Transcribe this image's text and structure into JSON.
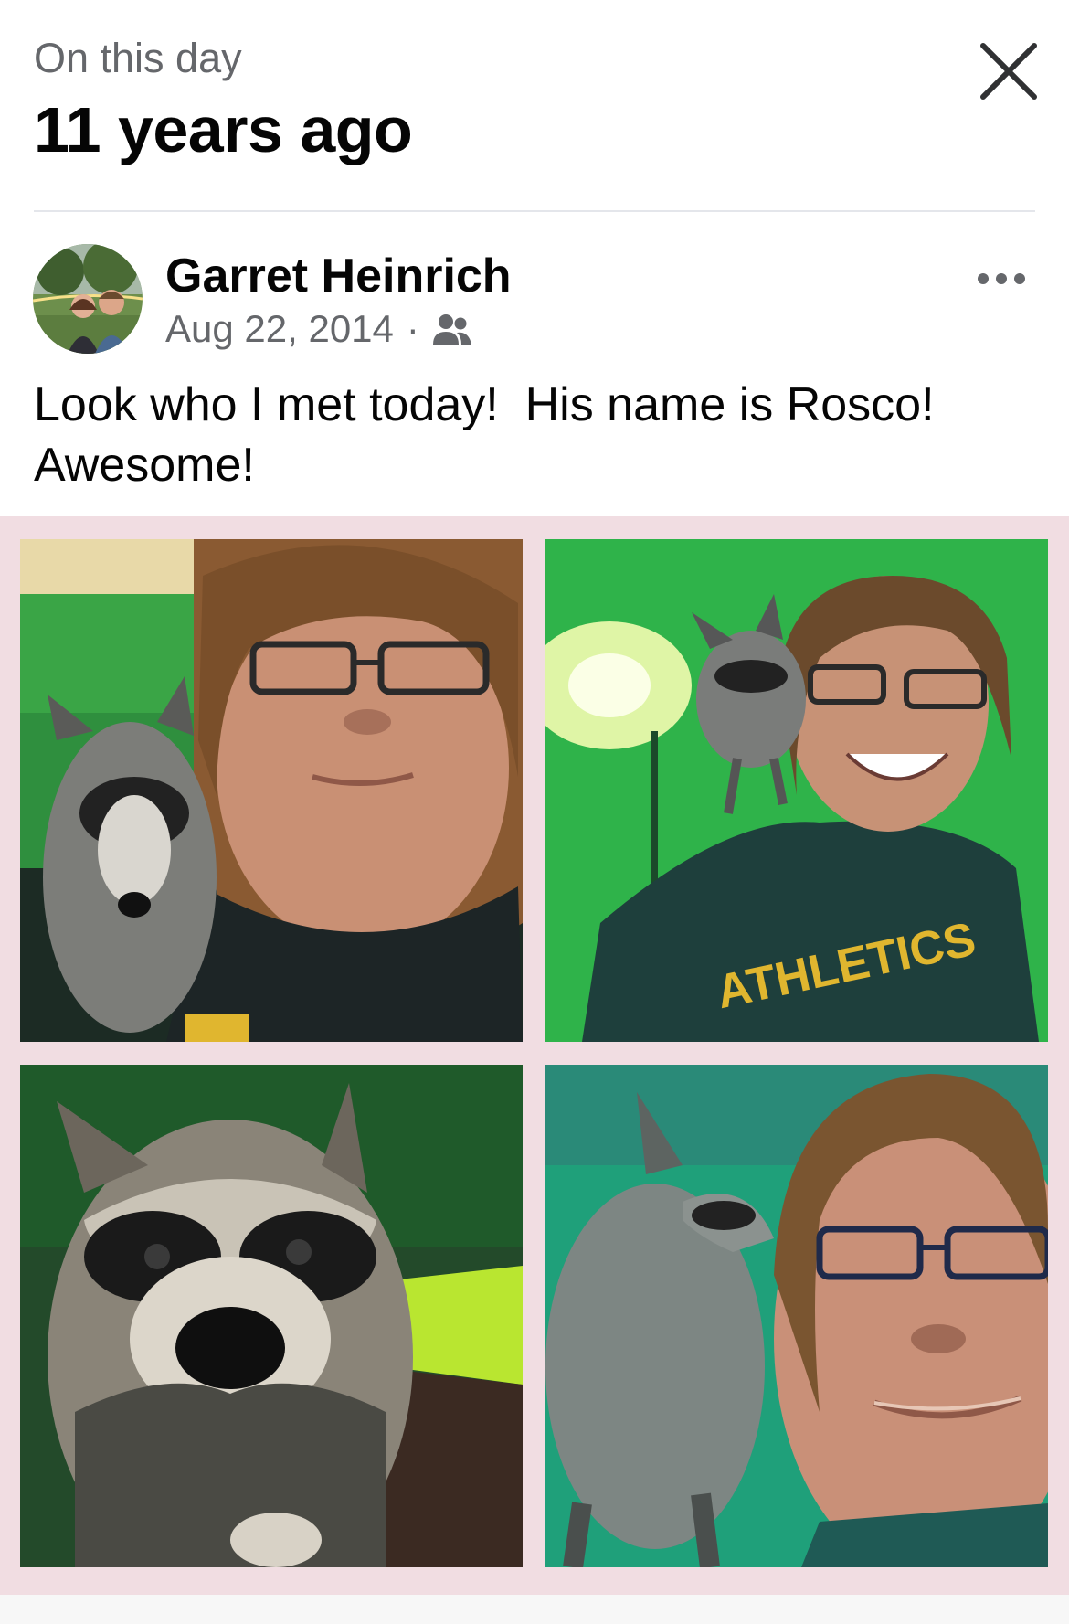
{
  "memory_header": {
    "kicker": "On this day",
    "headline": "11 years ago",
    "close_icon": "close-icon"
  },
  "post": {
    "author": "Garret Heinrich",
    "date": "Aug 22, 2014",
    "separator": "·",
    "audience_icon": "friends-icon",
    "more_icon": "more-horizontal-icon",
    "caption_line1": "Look who I met today!  His name is Rosco!",
    "caption_line2": "Awesome!",
    "tshirt_text": "ATHLETICS"
  },
  "colors": {
    "text_primary": "#050505",
    "text_secondary": "#65676b",
    "collage_border": "#f1dde2",
    "wall_green": "#2fb34a"
  }
}
